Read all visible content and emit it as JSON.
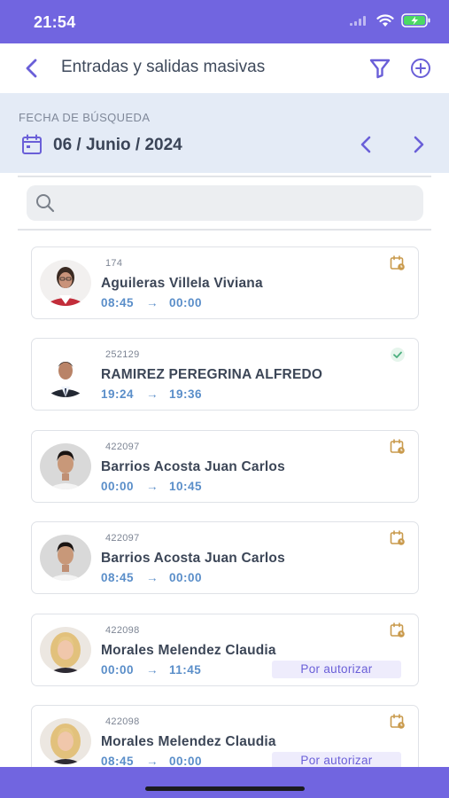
{
  "status_bar": {
    "time": "21:54"
  },
  "nav": {
    "title": "Entradas y salidas masivas"
  },
  "date_panel": {
    "label": "FECHA DE BÚSQUEDA",
    "value": "06 / Junio / 2024"
  },
  "search": {
    "placeholder": ""
  },
  "colors": {
    "brand": "#7165e0",
    "time_text": "#5a8ec9",
    "pending_icon": "#c99a4c",
    "check_icon": "#4caf7f"
  },
  "cards": [
    {
      "id": "174",
      "name": "Aguileras Villela Viviana",
      "time_in": "08:45",
      "arrow": "→",
      "time_out": "00:00",
      "status_icon": "calendar-pending-icon"
    },
    {
      "id": "252129",
      "name": "RAMIREZ PEREGRINA ALFREDO",
      "time_in": "19:24",
      "arrow": "→",
      "time_out": "19:36",
      "status_icon": "check-icon"
    },
    {
      "id": "422097",
      "name": "Barrios Acosta Juan Carlos",
      "time_in": "00:00",
      "arrow": "→",
      "time_out": "10:45",
      "status_icon": "calendar-pending-icon"
    },
    {
      "id": "422097",
      "name": "Barrios Acosta Juan Carlos",
      "time_in": "08:45",
      "arrow": "→",
      "time_out": "00:00",
      "status_icon": "calendar-pending-icon"
    },
    {
      "id": "422098",
      "name": "Morales Melendez Claudia",
      "time_in": "00:00",
      "arrow": "→",
      "time_out": "11:45",
      "status_icon": "calendar-pending-icon",
      "badge": "Por autorizar"
    },
    {
      "id": "422098",
      "name": "Morales Melendez Claudia",
      "time_in": "08:45",
      "arrow": "→",
      "time_out": "00:00",
      "status_icon": "calendar-pending-icon",
      "badge": "Por autorizar"
    }
  ]
}
